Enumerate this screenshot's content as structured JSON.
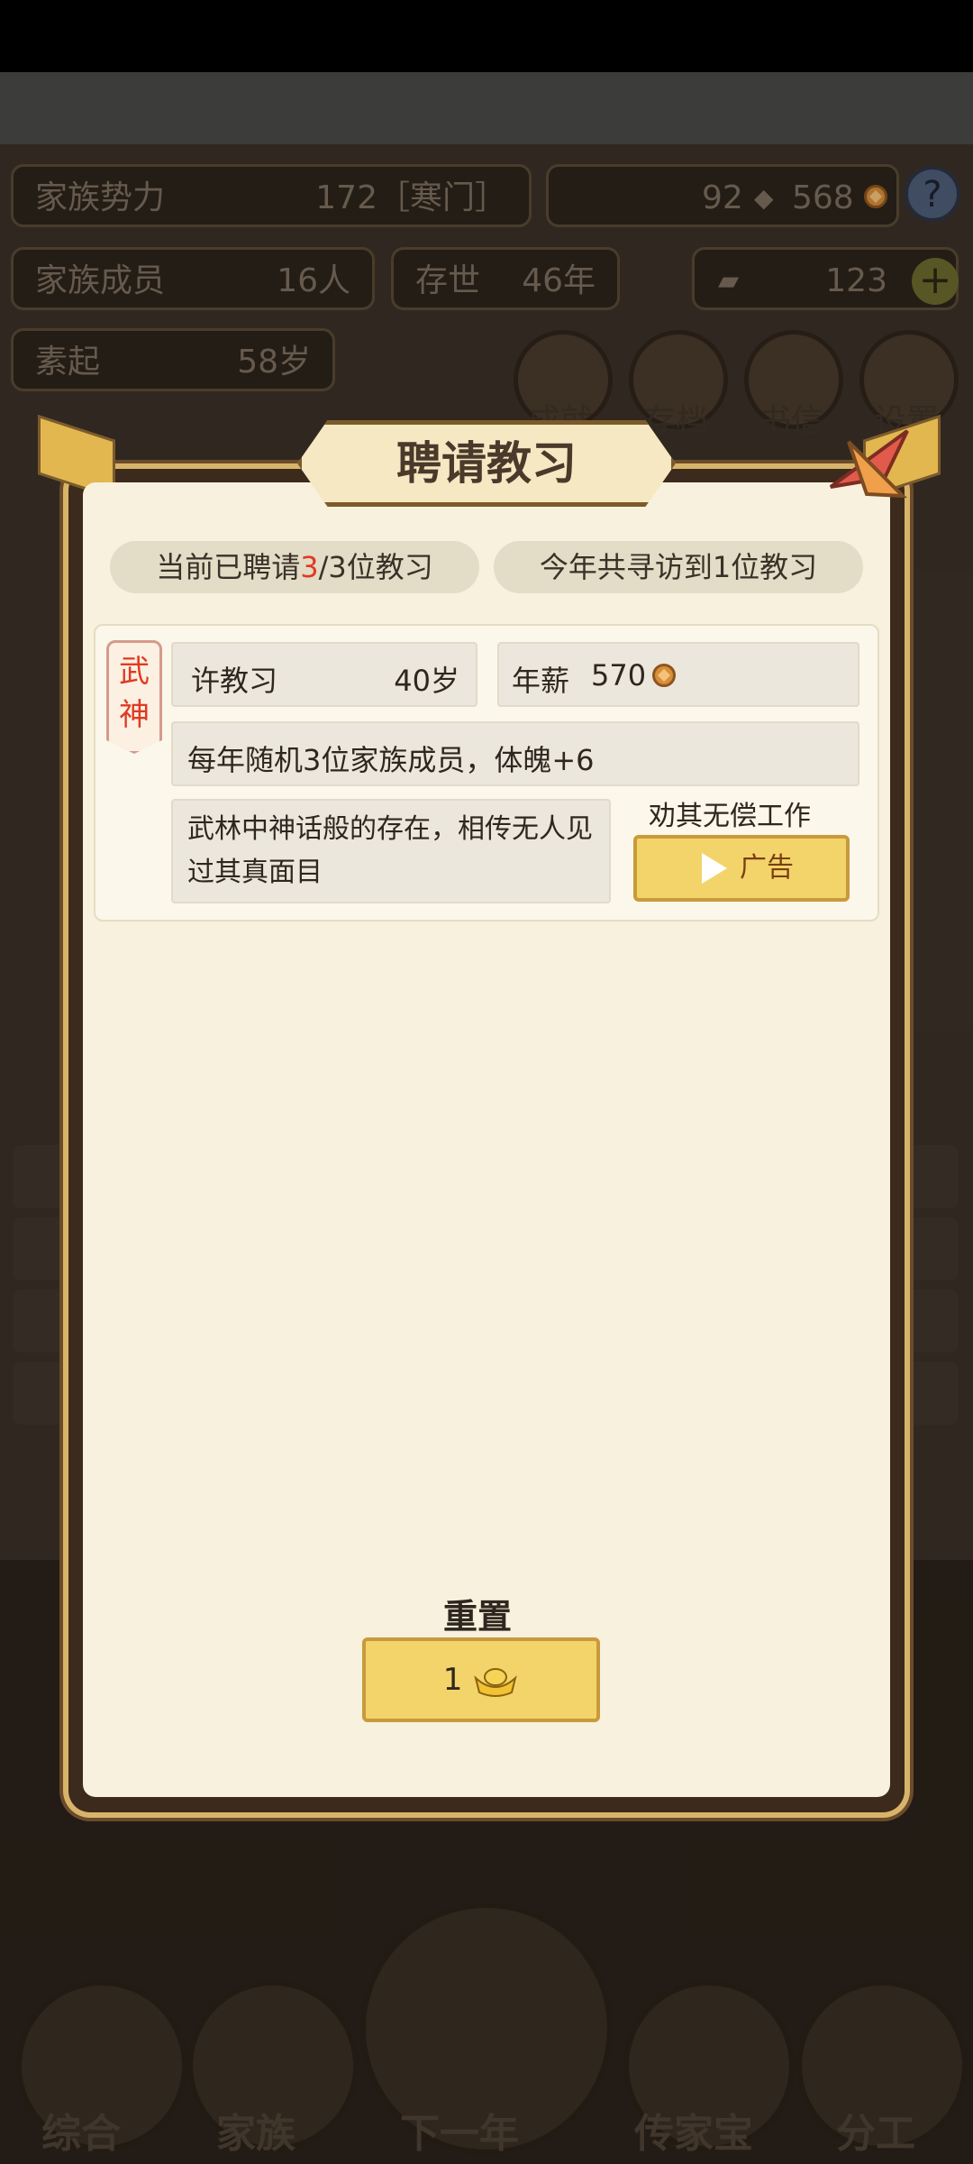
{
  "background": {
    "family_power_label": "家族势力",
    "family_power_value": "172［寒门］",
    "resources_value": "92",
    "resources_value2": "568",
    "members_label": "家族成员",
    "members_value": "16人",
    "existence_label": "存世",
    "existence_value": "46年",
    "gold_value": "123",
    "rise_label": "素起",
    "rise_value": "58岁",
    "menu_achievements": "成就",
    "menu_save": "存档",
    "menu_letters": "书信",
    "menu_settings": "设置",
    "bottom_nav": [
      "综合",
      "家族",
      "下一年",
      "传家宝",
      "分工"
    ]
  },
  "dialog": {
    "title": "聘请教习",
    "hired_prefix": "当前已聘请",
    "hired_count": "3",
    "hired_suffix": "/3位教习",
    "visited_text": "今年共寻访到1位教习",
    "tutor": {
      "tag": "武神",
      "name": "许教习",
      "age": "40岁",
      "salary_label": "年薪",
      "salary_value": "570",
      "effect": "每年随机3位家族成员，体魄+6",
      "description": "武林中神话般的存在，相传无人见过其真面目",
      "persuade_label": "劝其无偿工作",
      "ad_label": "广告"
    },
    "reset_label": "重置",
    "reset_cost": "1"
  },
  "colors": {
    "accent_gold": "#f3d46a",
    "highlight_red": "#e03a22",
    "dialog_bg": "#f7f1dd"
  }
}
